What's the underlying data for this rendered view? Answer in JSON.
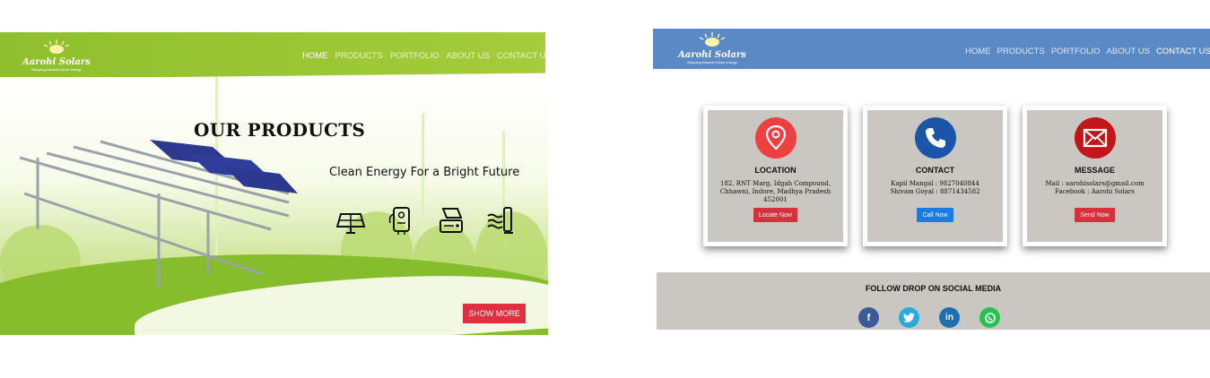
{
  "left_page": {
    "logo": {
      "brand": "Aarohi Solars",
      "tagline": "Stepping towards future energy"
    },
    "nav": [
      {
        "label": "HOME",
        "active": true
      },
      {
        "label": "PRODUCTS",
        "active": false
      },
      {
        "label": "PORTFOLIO",
        "active": false
      },
      {
        "label": "ABOUT US",
        "active": false
      },
      {
        "label": "CONTACT US",
        "active": false
      }
    ],
    "hero": {
      "title": "OUR PRODUCTS",
      "subtitle": "Clean Energy For a Bright Future",
      "product_icons": [
        "solar-panel-icon",
        "water-heater-icon",
        "solar-inverter-icon",
        "solar-pump-icon"
      ],
      "show_more_label": "SHOW MORE"
    },
    "colors": {
      "nav_green": "#9bc635",
      "button_red": "#e0303f"
    }
  },
  "right_page": {
    "logo": {
      "brand": "Aarohi Solars",
      "tagline": "Stepping towards future energy"
    },
    "nav": [
      {
        "label": "HOME",
        "active": false
      },
      {
        "label": "PRODUCTS",
        "active": false
      },
      {
        "label": "PORTFOLIO",
        "active": false
      },
      {
        "label": "ABOUT US",
        "active": false
      },
      {
        "label": "CONTACT US",
        "active": true
      }
    ],
    "cards": [
      {
        "icon": "location-pin-icon",
        "title": "LOCATION",
        "lines": [
          "182, RNT Marg, Idgah Compound,",
          "Chhawni, Indore, Madhya Pradesh",
          "452001"
        ],
        "button": "Locate Now",
        "button_color": "#d9303e",
        "circle_color": "#ee4040"
      },
      {
        "icon": "phone-icon",
        "title": "CONTACT",
        "lines": [
          "Kapil Mangal : 9827040844",
          "Shivam Goyal : 8871434582"
        ],
        "button": "Call Now",
        "button_color": "#1a7ae6",
        "circle_color": "#1b55a8"
      },
      {
        "icon": "mail-icon",
        "title": "MESSAGE",
        "lines": [
          "Mail : aarohisolars@gmail.com",
          "Facebook : Aarohi Solars"
        ],
        "button": "Send Now",
        "button_color": "#d9303e",
        "circle_color": "#c2161b"
      }
    ],
    "social": {
      "title": "FOLLOW DROP ON SOCIAL MEDIA",
      "icons": [
        {
          "name": "facebook-icon",
          "glyph": "f",
          "color": "#3b5a9a"
        },
        {
          "name": "twitter-icon",
          "glyph": "t",
          "color": "#29a9de"
        },
        {
          "name": "linkedin-icon",
          "glyph": "in",
          "color": "#1f6fb0"
        },
        {
          "name": "whatsapp-icon",
          "glyph": "w",
          "color": "#25c24e"
        }
      ]
    },
    "colors": {
      "nav_blue": "#5b89c6",
      "card_bg": "#cac7c2"
    }
  }
}
